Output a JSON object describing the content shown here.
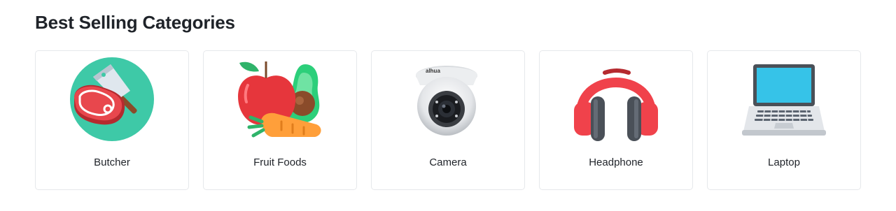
{
  "section": {
    "title": "Best Selling Categories"
  },
  "categories": [
    {
      "label": "Butcher",
      "icon": "butcher-icon"
    },
    {
      "label": "Fruit Foods",
      "icon": "fruit-foods-icon"
    },
    {
      "label": "Camera",
      "icon": "camera-icon"
    },
    {
      "label": "Headphone",
      "icon": "headphone-icon"
    },
    {
      "label": "Laptop",
      "icon": "laptop-icon"
    }
  ],
  "colors": {
    "card_border": "#e6e8eb",
    "text": "#1f2329"
  }
}
